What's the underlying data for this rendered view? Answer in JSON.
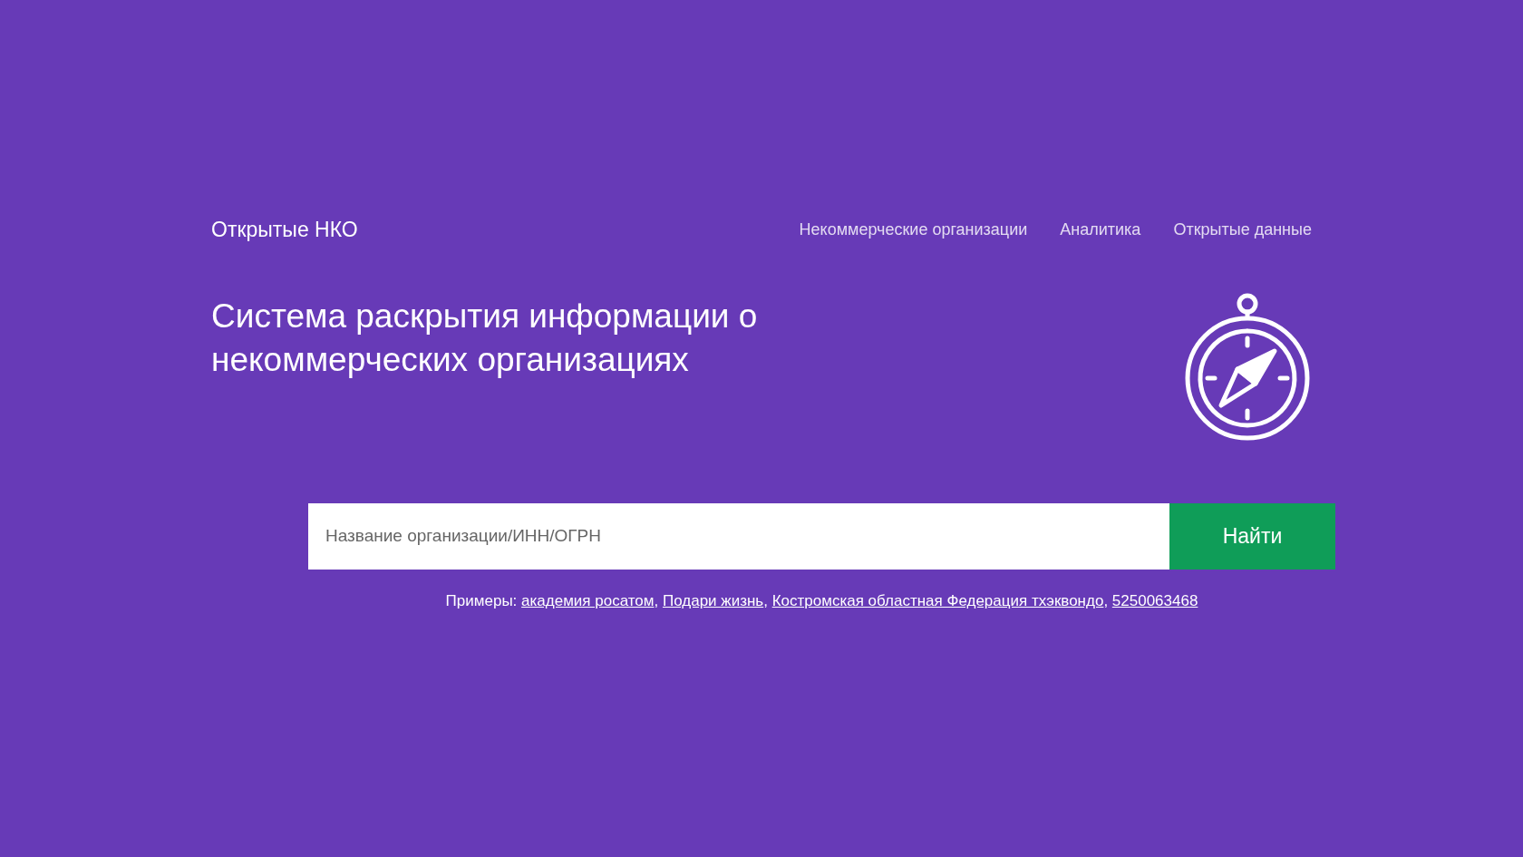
{
  "header": {
    "logo": "Открытые НКО",
    "nav": [
      {
        "label": "Некоммерческие организации"
      },
      {
        "label": "Аналитика"
      },
      {
        "label": "Открытые данные"
      }
    ]
  },
  "hero": {
    "title": "Система раскрытия информации о некоммерческих организациях"
  },
  "search": {
    "placeholder": "Название организации/ИНН/ОГРН",
    "button": "Найти"
  },
  "examples": {
    "label": "Примеры:",
    "separator": ",",
    "links": [
      "академия росатом",
      "Подари жизнь",
      "Костромская областная Федерация тхэквондо",
      "5250063468"
    ]
  }
}
